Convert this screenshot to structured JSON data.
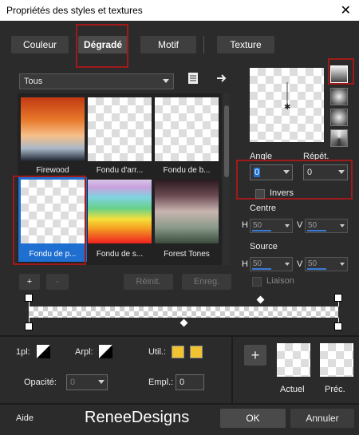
{
  "window": {
    "title": "Propriétés des styles et textures",
    "close": "✕"
  },
  "tabs": [
    {
      "label": "Couleur"
    },
    {
      "label": "Dégradé",
      "selected": true
    },
    {
      "label": "Motif"
    },
    {
      "label": "Texture"
    }
  ],
  "category": {
    "selected": "Tous"
  },
  "gradients": [
    {
      "label": "Firewood"
    },
    {
      "label": "Fondu d'arr..."
    },
    {
      "label": "Fondu de b..."
    },
    {
      "label": "Fondu de p...",
      "selected": true
    },
    {
      "label": "Fondu de s..."
    },
    {
      "label": "Forest Tones"
    }
  ],
  "list_buttons": {
    "add": "+",
    "remove": "-",
    "reset": "Réinit.",
    "save": "Enreg."
  },
  "angle": {
    "label": "Angle",
    "value": "0"
  },
  "repeat": {
    "label": "Répét.",
    "value": "0"
  },
  "invert": {
    "label": "Invers",
    "checked": false
  },
  "center": {
    "label": "Centre",
    "h_label": "H",
    "h": "50",
    "v_label": "V",
    "v": "50"
  },
  "source": {
    "label": "Source",
    "h_label": "H",
    "h": "50",
    "v_label": "V",
    "v": "50"
  },
  "link": {
    "label": "Liaison"
  },
  "stops": {
    "ipl_label": "1pl:",
    "arpl_label": "Arpl:",
    "util_label": "Util.:",
    "opacity_label": "Opacité:",
    "opacity_value": "0",
    "empl_label": "Empl.:",
    "empl_value": "0",
    "swatch_color": "#f1c232"
  },
  "preview_swatches": {
    "add": "+",
    "current": "Actuel",
    "previous": "Préc."
  },
  "footer": {
    "help": "Aide",
    "watermark": "ReneeDesigns",
    "ok": "OK",
    "cancel": "Annuler"
  },
  "colors": {
    "accent": "#3a7bd5",
    "highlight": "#a01a1a",
    "selection": "#1f6fd1"
  }
}
